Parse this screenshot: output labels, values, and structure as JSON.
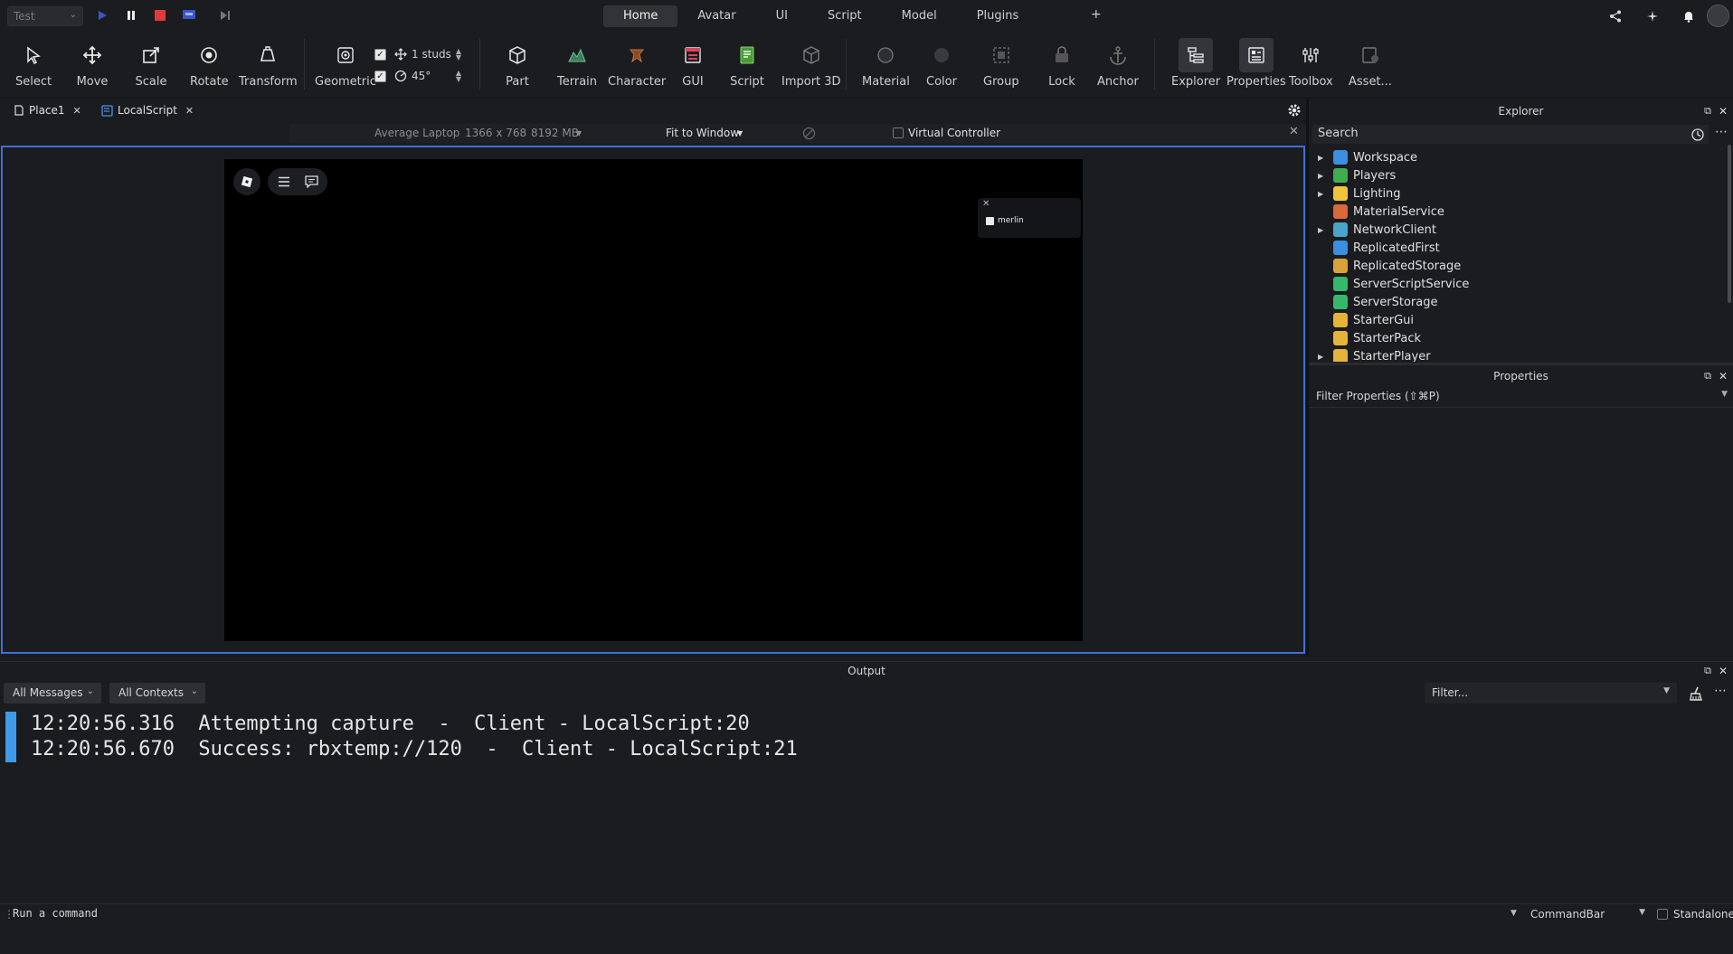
{
  "topbar": {
    "test_mode": "Test",
    "menu_tabs": [
      "Home",
      "Avatar",
      "UI",
      "Script",
      "Model",
      "Plugins"
    ],
    "plus": "+"
  },
  "ribbon": {
    "select": "Select",
    "move": "Move",
    "scale": "Scale",
    "rotate": "Rotate",
    "transform": "Transform",
    "geometric": "Geometric",
    "move_snap": "1 studs",
    "rotate_snap": "45°",
    "part": "Part",
    "terrain": "Terrain",
    "character": "Character",
    "gui": "GUI",
    "script": "Script",
    "import3d": "Import 3D",
    "material": "Material",
    "color": "Color",
    "group": "Group",
    "lock": "Lock",
    "anchor": "Anchor",
    "explorer": "Explorer",
    "properties": "Properties",
    "toolbox": "Toolbox",
    "asset": "Asset..."
  },
  "doc_tabs": [
    "Place1",
    "LocalScript"
  ],
  "device_bar": {
    "device": "Average Laptop",
    "resolution": "1366 x 768",
    "memory": "8192 MB",
    "fit": "Fit to Window",
    "virtual_controller": "Virtual Controller"
  },
  "game": {
    "player_name": "merlin"
  },
  "explorer": {
    "title": "Explorer",
    "search_placeholder": "Search",
    "items": [
      {
        "label": "Workspace",
        "expandable": true,
        "color": "#3b8fe0"
      },
      {
        "label": "Players",
        "expandable": true,
        "color": "#3fae4f"
      },
      {
        "label": "Lighting",
        "expandable": true,
        "color": "#f0c53a"
      },
      {
        "label": "MaterialService",
        "expandable": false,
        "color": "#d9683a"
      },
      {
        "label": "NetworkClient",
        "expandable": true,
        "color": "#47a6c9"
      },
      {
        "label": "ReplicatedFirst",
        "expandable": false,
        "color": "#3b8fe0"
      },
      {
        "label": "ReplicatedStorage",
        "expandable": false,
        "color": "#d9a23a"
      },
      {
        "label": "ServerScriptService",
        "expandable": false,
        "color": "#35b86b"
      },
      {
        "label": "ServerStorage",
        "expandable": false,
        "color": "#35b86b"
      },
      {
        "label": "StarterGui",
        "expandable": false,
        "color": "#e6b33a"
      },
      {
        "label": "StarterPack",
        "expandable": false,
        "color": "#e6b33a"
      },
      {
        "label": "StarterPlayer",
        "expandable": true,
        "color": "#e6b33a"
      }
    ]
  },
  "properties": {
    "title": "Properties",
    "filter_placeholder": "Filter Properties (⇧⌘P)"
  },
  "output": {
    "title": "Output",
    "messages_filter": "All Messages",
    "contexts_filter": "All Contexts",
    "filter_placeholder": "Filter...",
    "lines": [
      "12:20:56.316  Attempting capture  -  Client - LocalScript:20",
      "12:20:56.670  Success: rbxtemp://120  -  Client - LocalScript:21"
    ]
  },
  "command_bar": {
    "placeholder": "Run a command",
    "mode": "CommandBar",
    "standalone": "Standalone"
  },
  "colors": {
    "accent_blue": "#3f6fd8",
    "log_bar": "#3d9be9",
    "stop_red": "#e03b3b"
  }
}
